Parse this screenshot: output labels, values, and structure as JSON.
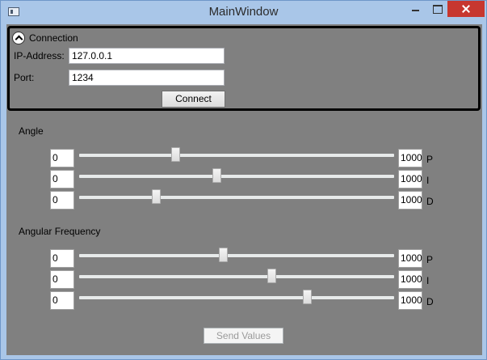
{
  "window": {
    "title": "MainWindow"
  },
  "connection": {
    "header": "Connection",
    "ip_label": "IP-Address:",
    "ip_value": "127.0.0.1",
    "port_label": "Port:",
    "port_value": "1234",
    "connect_label": "Connect"
  },
  "angle": {
    "label": "Angle",
    "rows": [
      {
        "name": "P",
        "min": "0",
        "max": "1000",
        "value": 300
      },
      {
        "name": "I",
        "min": "0",
        "max": "1000",
        "value": 434
      },
      {
        "name": "D",
        "min": "0",
        "max": "1000",
        "value": 238
      }
    ]
  },
  "angular_frequency": {
    "label": "Angular Frequency",
    "rows": [
      {
        "name": "P",
        "min": "0",
        "max": "1000",
        "value": 455
      },
      {
        "name": "I",
        "min": "0",
        "max": "1000",
        "value": 614
      },
      {
        "name": "D",
        "min": "0",
        "max": "1000",
        "value": 729
      }
    ]
  },
  "send_label": "Send Values"
}
